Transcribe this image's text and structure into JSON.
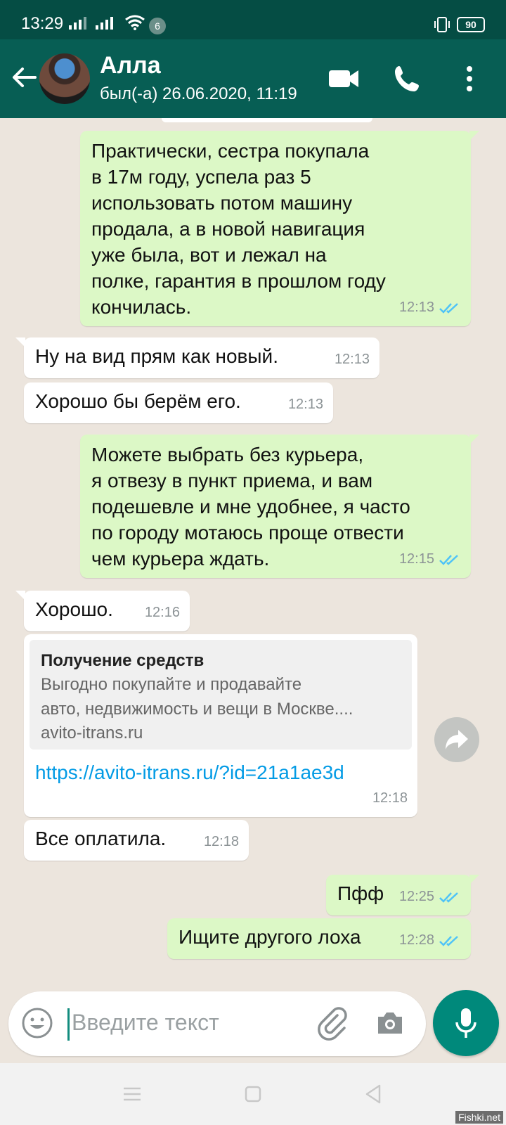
{
  "status_bar": {
    "time": "13:29",
    "notif_count": "6",
    "battery": "90"
  },
  "header": {
    "contact_name": "Алла",
    "last_seen": "был(-а) 26.06.2020, 11:19"
  },
  "messages": [
    {
      "dir": "out",
      "text": "Практически, сестра покупала\nв 17м году, успела раз 5\nиспользовать потом машину\nпродала, а в новой навигация\nуже была, вот и лежал на\nполке, гарантия в прошлом году\nкончилась.",
      "time": "12:13"
    },
    {
      "dir": "in",
      "text": "Ну на вид прям как новый.",
      "time": "12:13"
    },
    {
      "dir": "in",
      "text": "Хорошо бы берём его.",
      "time": "12:13"
    },
    {
      "dir": "out",
      "text": "Можете выбрать без курьера,\nя отвезу в пункт приема, и вам\nподешевле и мне удобнее, я часто\nпо городу мотаюсь проще отвести\nчем курьера ждать.",
      "time": "12:15"
    },
    {
      "dir": "in",
      "text": "Хорошо.",
      "time": "12:16"
    },
    {
      "dir": "in",
      "type": "link",
      "preview_title": "Получение средств",
      "preview_desc": "Выгодно покупайте и продавайте\nавто, недвижимость и вещи в Москве....",
      "preview_domain": "avito-itrans.ru",
      "url": "https://avito-itrans.ru/?id=21a1ae3d",
      "time": "12:18"
    },
    {
      "dir": "in",
      "text": "Все оплатила.",
      "time": "12:18"
    },
    {
      "dir": "out",
      "text": "Пфф",
      "time": "12:25"
    },
    {
      "dir": "out",
      "text": "Ищите другого лоха",
      "time": "12:28"
    }
  ],
  "input": {
    "placeholder": "Введите текст"
  },
  "watermark": "Fishki.net",
  "colors": {
    "header": "#075e54",
    "outgoing": "#dcf8c6",
    "incoming": "#ffffff",
    "ticks": "#4fc3f7",
    "mic": "#00897b",
    "link": "#039be5"
  },
  "icons": [
    "back-arrow-icon",
    "video-call-icon",
    "phone-icon",
    "more-vert-icon",
    "forward-icon",
    "emoji-icon",
    "attach-icon",
    "camera-icon",
    "mic-icon"
  ]
}
